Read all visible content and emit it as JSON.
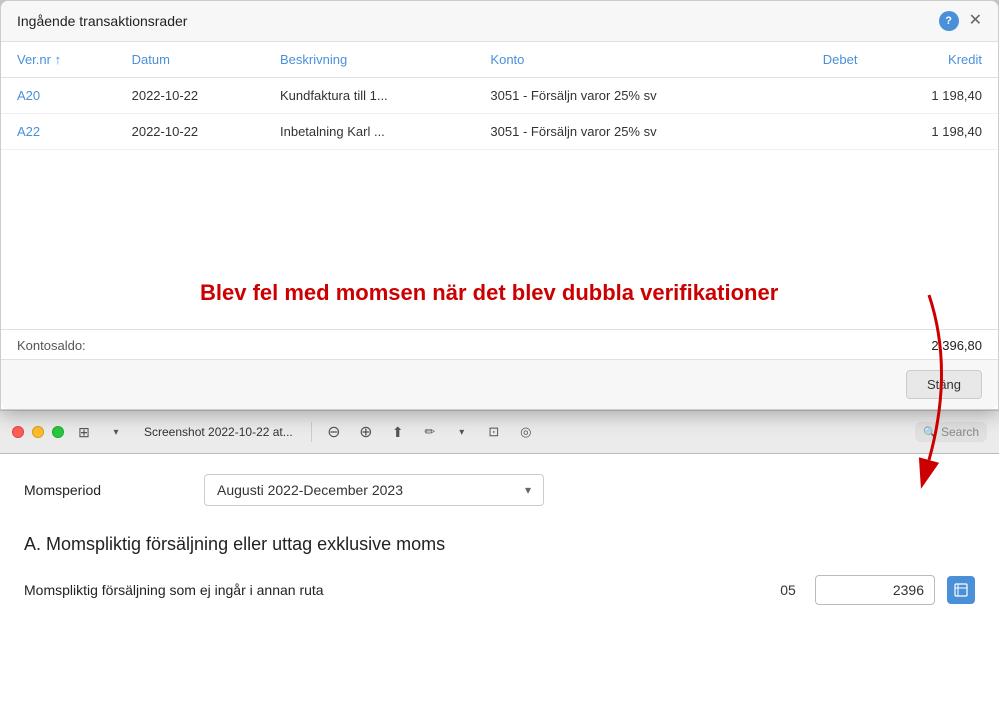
{
  "modal": {
    "title": "Ingående transaktionsrader",
    "columns": [
      "Ver.nr",
      "Datum",
      "Beskrivning",
      "Konto",
      "Debet",
      "Kredit"
    ],
    "sort_col": "Ver.nr",
    "sort_dir": "asc",
    "rows": [
      {
        "ver_nr": "A20",
        "datum": "2022-10-22",
        "beskrivning": "Kundfaktura till 1...",
        "konto": "3051 - Försäljn varor 25% sv",
        "debet": "",
        "kredit": "1 198,40"
      },
      {
        "ver_nr": "A22",
        "datum": "2022-10-22",
        "beskrivning": "Inbetalning Karl ...",
        "konto": "3051 - Försäljn varor 25% sv",
        "debet": "",
        "kredit": "1 198,40"
      }
    ],
    "kontosaldo_label": "Kontosaldo:",
    "kontosaldo_value": "2 396,80",
    "close_btn": "Stäng"
  },
  "annotation": {
    "text": "Blev fel med momsen när det blev dubbla verifikationer"
  },
  "macos_bar": {
    "window_title": "Screenshot 2022-10-22 at...",
    "search_placeholder": "Search"
  },
  "bottom": {
    "momsperiod_label": "Momsperiod",
    "momsperiod_value": "Augusti 2022-December 2023",
    "section_heading": "A. Momspliktig försäljning eller uttag exklusive moms",
    "row_label": "Momspliktig försäljning som ej ingår i annan ruta",
    "row_code": "05",
    "row_value": "2396"
  }
}
